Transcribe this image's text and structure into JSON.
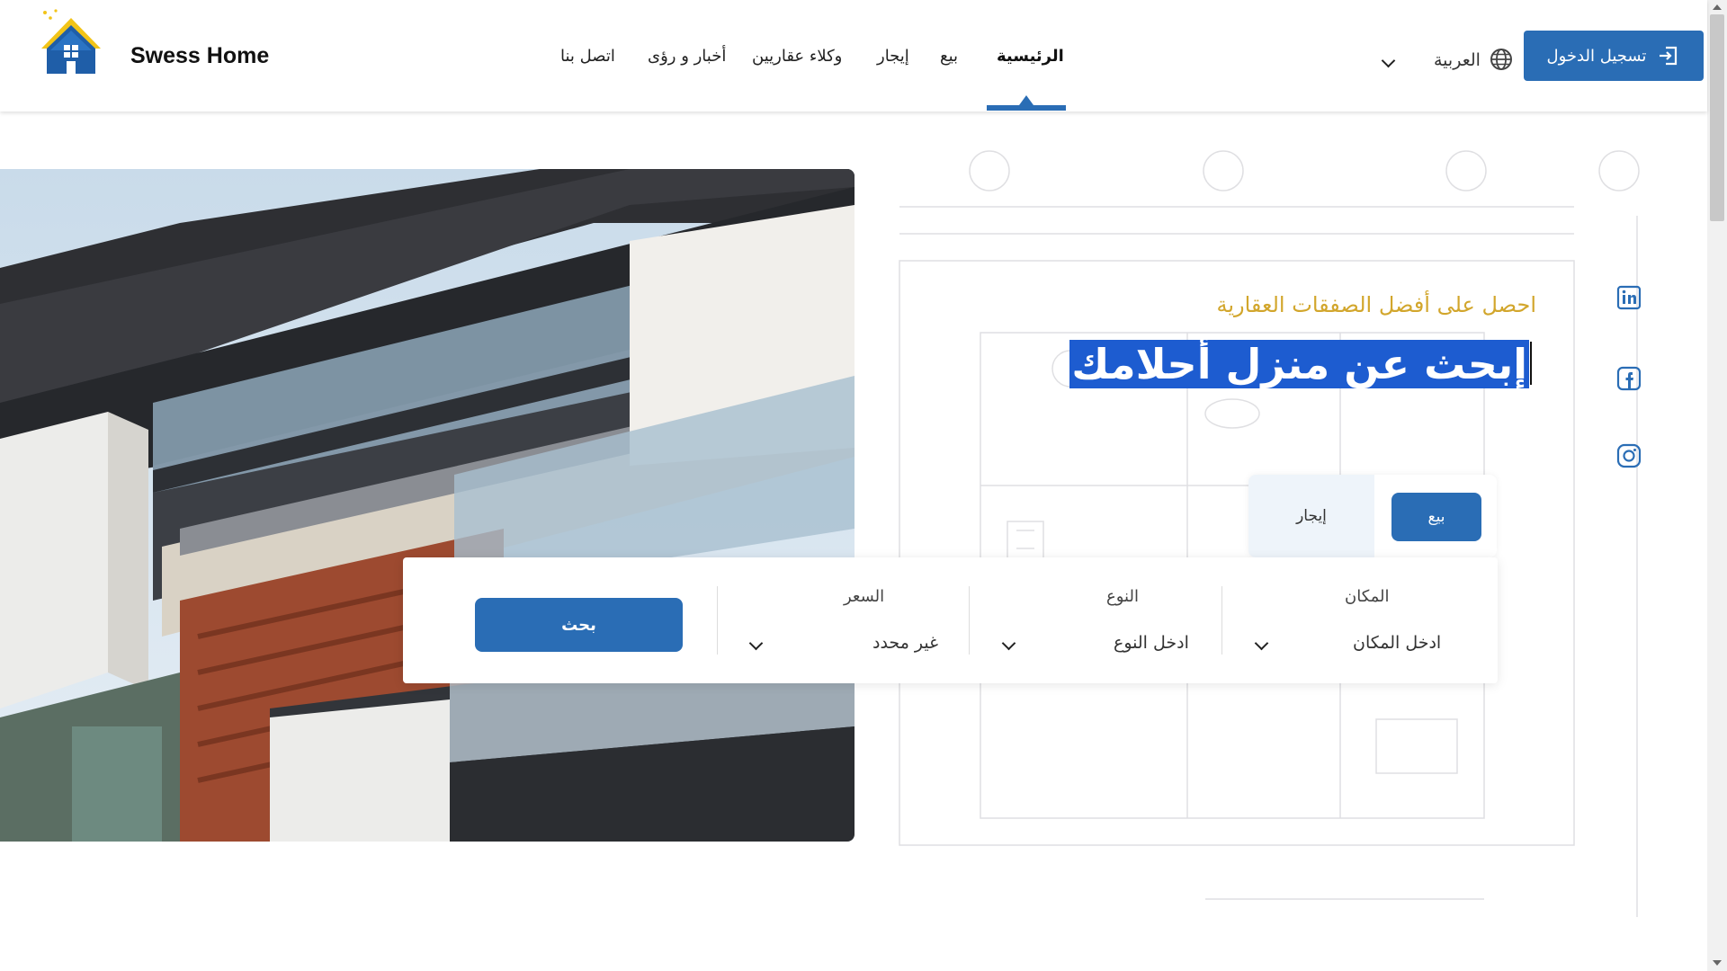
{
  "header": {
    "brand": "Swess Home",
    "nav": [
      {
        "label": "الرئيسية",
        "active": true
      },
      {
        "label": "بيع"
      },
      {
        "label": "إيجار"
      },
      {
        "label": "وكلاء عقاريين"
      },
      {
        "label": "أخبار و رؤى"
      },
      {
        "label": "اتصل بنا"
      }
    ],
    "language": "العربية",
    "login_label": "تسجيل الدخول"
  },
  "hero": {
    "subtitle": "احصل على أفضل الصفقات العقارية",
    "headline": "إبحث عن منزل أحلامك"
  },
  "tabs": {
    "sale": "بيع",
    "rent": "إيجار"
  },
  "search": {
    "location": {
      "label": "المكان",
      "value": "ادخل المكان"
    },
    "type": {
      "label": "النوع",
      "value": "ادخل النوع"
    },
    "price": {
      "label": "السعر",
      "value": "غير محدد"
    },
    "button": "بحث"
  },
  "social": [
    "linkedin-icon",
    "facebook-icon",
    "instagram-icon"
  ],
  "colors": {
    "primary": "#2a6db5",
    "accent": "#d2a62c",
    "selection": "#1d5cd0"
  }
}
